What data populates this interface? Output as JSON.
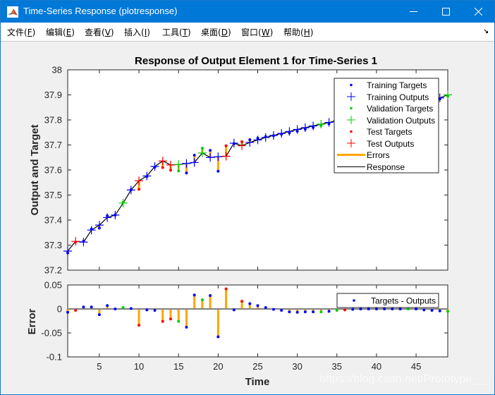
{
  "window": {
    "title": "Time-Series Response (plotresponse)",
    "icon": "matlab-icon",
    "controls": [
      "minimize",
      "maximize",
      "close"
    ]
  },
  "menubar": {
    "items": [
      {
        "label": "文件",
        "key": "F"
      },
      {
        "label": "编辑",
        "key": "E"
      },
      {
        "label": "查看",
        "key": "V"
      },
      {
        "label": "插入",
        "key": "I"
      },
      {
        "label": "工具",
        "key": "T"
      },
      {
        "label": "桌面",
        "key": "D"
      },
      {
        "label": "窗口",
        "key": "W"
      },
      {
        "label": "帮助",
        "key": "H"
      }
    ],
    "dock_icon": "dock-arrow-icon"
  },
  "colors": {
    "training": "#0000ff",
    "validation": "#00cc00",
    "test": "#ff0000",
    "errors": "#ffa500",
    "response": "#000000",
    "zero_line": "#808080",
    "titlebar": "#0078d7"
  },
  "watermark": "https://blog.csdn.net/Prototype___",
  "chart_data": [
    {
      "type": "line",
      "title": "Response of Output Element 1 for Time-Series 1",
      "xlabel": "",
      "ylabel": "Output and Target",
      "xlim": [
        1,
        49
      ],
      "ylim": [
        37.2,
        38
      ],
      "xticks": [
        5,
        10,
        15,
        20,
        25,
        30,
        35,
        40,
        45
      ],
      "yticks": [
        37.2,
        37.3,
        37.4,
        37.5,
        37.6,
        37.7,
        37.8,
        37.9,
        38
      ],
      "ytick_labels": [
        "37.2",
        "37.3",
        "37.4",
        "37.5",
        "37.6",
        "37.7",
        "37.8",
        "37.9",
        "38"
      ],
      "grid": false,
      "legend_position": "top-right",
      "legend": [
        "Training Targets",
        "Training Outputs",
        "Validation Targets",
        "Validation Outputs",
        "Test Targets",
        "Test Outputs",
        "Errors",
        "Response"
      ],
      "x": [
        1,
        2,
        3,
        4,
        5,
        6,
        7,
        8,
        9,
        10,
        11,
        12,
        13,
        14,
        15,
        16,
        17,
        18,
        19,
        20,
        21,
        22,
        23,
        24,
        25,
        26,
        27,
        28,
        29,
        30,
        31,
        32,
        33,
        34,
        35,
        36,
        37,
        38,
        39,
        40,
        41,
        42,
        43,
        44,
        45,
        46,
        47,
        48,
        49
      ],
      "set": [
        "train",
        "test",
        "train",
        "train",
        "train",
        "train",
        "train",
        "val",
        "train",
        "test",
        "train",
        "train",
        "test",
        "test",
        "val",
        "train",
        "train",
        "val",
        "train",
        "train",
        "test",
        "train",
        "test",
        "train",
        "train",
        "train",
        "train",
        "train",
        "train",
        "train",
        "train",
        "train",
        "val",
        "train",
        "val",
        "test",
        "train",
        "train",
        "train",
        "train",
        "train",
        "train",
        "train",
        "val",
        "train",
        "train",
        "train",
        "train",
        "val"
      ],
      "outputs": [
        37.276,
        37.315,
        37.312,
        37.36,
        37.38,
        37.41,
        37.42,
        37.468,
        37.52,
        37.557,
        37.576,
        37.614,
        37.636,
        37.62,
        37.622,
        37.626,
        37.63,
        37.668,
        37.65,
        37.653,
        37.655,
        37.707,
        37.697,
        37.71,
        37.72,
        37.73,
        37.738,
        37.746,
        37.754,
        37.762,
        37.769,
        37.776,
        37.783,
        37.79,
        37.797,
        37.803,
        37.809,
        37.815,
        37.821,
        37.828,
        37.834,
        37.84,
        37.846,
        37.852,
        37.858,
        37.865,
        37.872,
        37.888,
        37.9
      ],
      "errors": [
        -0.007,
        -0.003,
        0.004,
        0.004,
        -0.012,
        0.007,
        0.0,
        0.003,
        0.001,
        -0.034,
        -0.002,
        -0.003,
        -0.026,
        -0.021,
        -0.026,
        -0.038,
        0.029,
        0.019,
        0.028,
        -0.058,
        0.042,
        -0.002,
        0.016,
        0.011,
        0.007,
        0.003,
        -0.001,
        -0.003,
        -0.006,
        -0.007,
        -0.006,
        -0.006,
        -0.006,
        -0.005,
        -0.003,
        -0.002,
        -0.001,
        0.0,
        0.0,
        0.0,
        0.0,
        0.0,
        0.0,
        0.0,
        0.0,
        -0.002,
        -0.003,
        -0.004,
        -0.005
      ]
    },
    {
      "type": "bar",
      "title": "",
      "xlabel": "Time",
      "ylabel": "Error",
      "xlim": [
        1,
        49
      ],
      "ylim": [
        -0.1,
        0.05
      ],
      "xticks": [
        5,
        10,
        15,
        20,
        25,
        30,
        35,
        40,
        45
      ],
      "xtick_labels": [
        "5",
        "10",
        "15",
        "20",
        "25",
        "30",
        "35",
        "40",
        "45"
      ],
      "yticks": [
        -0.1,
        -0.05,
        0,
        0.05
      ],
      "ytick_labels": [
        "-0.1",
        "-0.05",
        "0",
        "0.05"
      ],
      "grid": false,
      "legend_position": "top-right",
      "legend": [
        "Targets - Outputs"
      ],
      "series_ref": "uses x, set and errors from the first chart"
    }
  ]
}
